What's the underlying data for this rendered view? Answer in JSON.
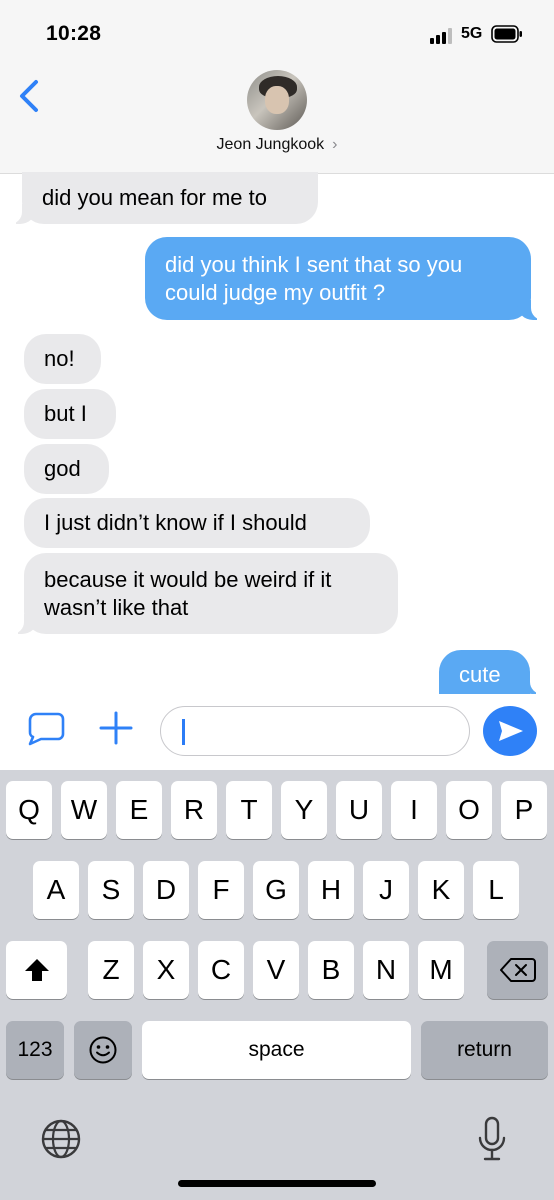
{
  "status_bar": {
    "time": "10:28",
    "network": "5G"
  },
  "header": {
    "contact_name": "Jeon Jungkook",
    "chevron": "›",
    "back_icon": "chevron-left-icon"
  },
  "messages": [
    {
      "direction": "incoming",
      "text": "did you mean for me to"
    },
    {
      "direction": "outgoing",
      "text": "did you think I sent that so you could judge my outfit ?"
    },
    {
      "direction": "incoming",
      "text": "no!"
    },
    {
      "direction": "incoming",
      "text": "but I"
    },
    {
      "direction": "incoming",
      "text": "god"
    },
    {
      "direction": "incoming",
      "text": "I just didn’t know if I should"
    },
    {
      "direction": "incoming",
      "text": "because it would be weird if it wasn’t like that"
    },
    {
      "direction": "outgoing",
      "text": "cute"
    }
  ],
  "compose": {
    "value": "",
    "apps_icon": "app-store-icon",
    "add_icon": "plus-icon",
    "send_icon": "send-arrow-icon"
  },
  "keyboard": {
    "row1": [
      "Q",
      "W",
      "E",
      "R",
      "T",
      "Y",
      "U",
      "I",
      "O",
      "P"
    ],
    "row2": [
      "A",
      "S",
      "D",
      "F",
      "G",
      "H",
      "J",
      "K",
      "L"
    ],
    "row3": [
      "Z",
      "X",
      "C",
      "V",
      "B",
      "N",
      "M"
    ],
    "numbers_label": "123",
    "space_label": "space",
    "return_label": "return",
    "shift_icon": "shift-icon",
    "delete_icon": "delete-icon",
    "emoji_icon": "emoji-icon",
    "globe_icon": "globe-icon",
    "mic_icon": "microphone-icon"
  },
  "colors": {
    "outgoing_bubble": "#5aa9f3",
    "incoming_bubble": "#e9e9eb",
    "accent": "#2f81f7"
  }
}
